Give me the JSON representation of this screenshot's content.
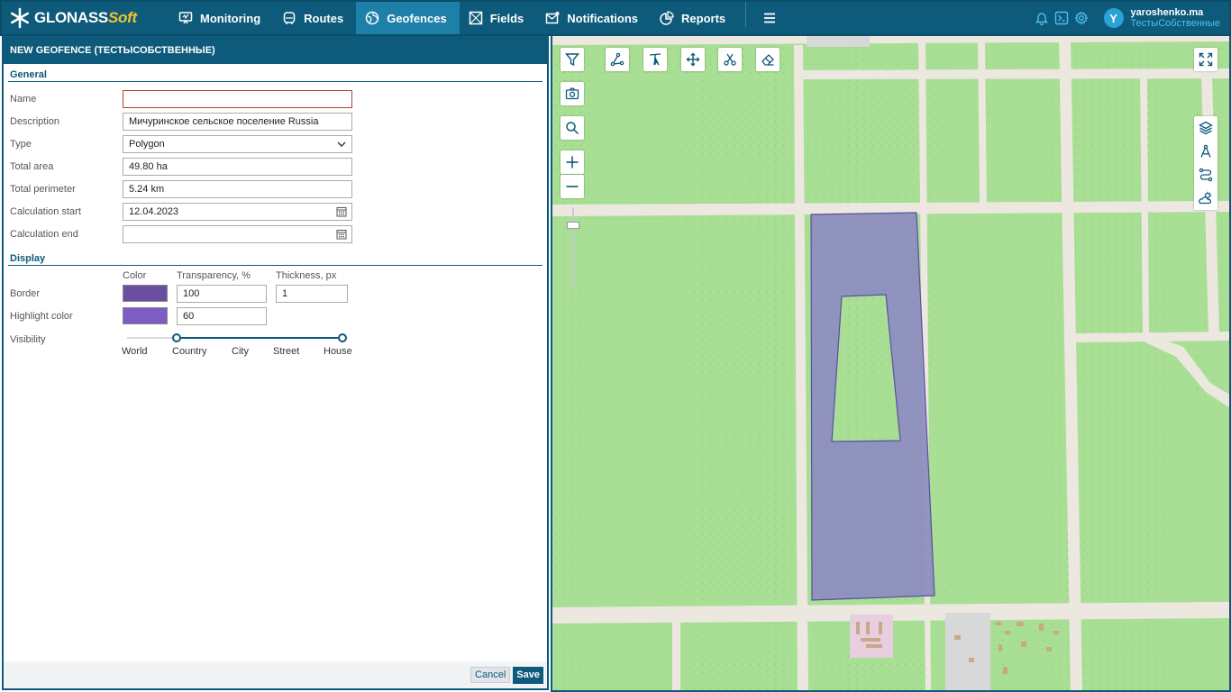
{
  "app": {
    "logo_main": "GLONASS",
    "logo_accent": "Soft"
  },
  "nav": {
    "items": [
      {
        "label": "Monitoring",
        "icon": "monitoring-icon",
        "active": false
      },
      {
        "label": "Routes",
        "icon": "routes-icon",
        "active": false
      },
      {
        "label": "Geofences",
        "icon": "geofences-icon",
        "active": true
      },
      {
        "label": "Fields",
        "icon": "fields-icon",
        "active": false
      },
      {
        "label": "Notifications",
        "icon": "notifications-icon",
        "active": false
      },
      {
        "label": "Reports",
        "icon": "reports-icon",
        "active": false
      }
    ]
  },
  "user": {
    "initial": "Y",
    "name": "yaroshenko.ma",
    "org": "ТестыСобственные"
  },
  "panel": {
    "title": "NEW GEOFENCE (ТЕСТЫСОБСТВЕННЫЕ)",
    "general_title": "General",
    "fields": {
      "name": {
        "label": "Name",
        "value": ""
      },
      "description": {
        "label": "Description",
        "value": "Мичуринское сельское поселение Russia"
      },
      "type": {
        "label": "Type",
        "value": "Polygon"
      },
      "total_area": {
        "label": "Total area",
        "value": "49.80 ha"
      },
      "total_perimeter": {
        "label": "Total perimeter",
        "value": "5.24 km"
      },
      "calc_start": {
        "label": "Calculation start",
        "value": "12.04.2023"
      },
      "calc_end": {
        "label": "Calculation end",
        "value": ""
      }
    },
    "display_title": "Display",
    "display_cols": {
      "color": "Color",
      "transparency": "Transparency, %",
      "thickness": "Thickness, px"
    },
    "border": {
      "label": "Border",
      "color": "#6a4fa0",
      "transparency": "100",
      "thickness": "1"
    },
    "highlight": {
      "label": "Highlight color",
      "color": "#7e5cc4",
      "transparency": "60"
    },
    "visibility": {
      "label": "Visibility",
      "levels": [
        "World",
        "Country",
        "City",
        "Street",
        "House"
      ],
      "range_from": "Country",
      "range_to": "House"
    },
    "cancel": "Cancel",
    "save": "Save"
  },
  "map": {
    "colors": {
      "land": "#a8df95",
      "road": "#ece8e0",
      "polygon_fill": "#8f8fc0",
      "polygon_stroke": "#5a4fa0"
    }
  }
}
